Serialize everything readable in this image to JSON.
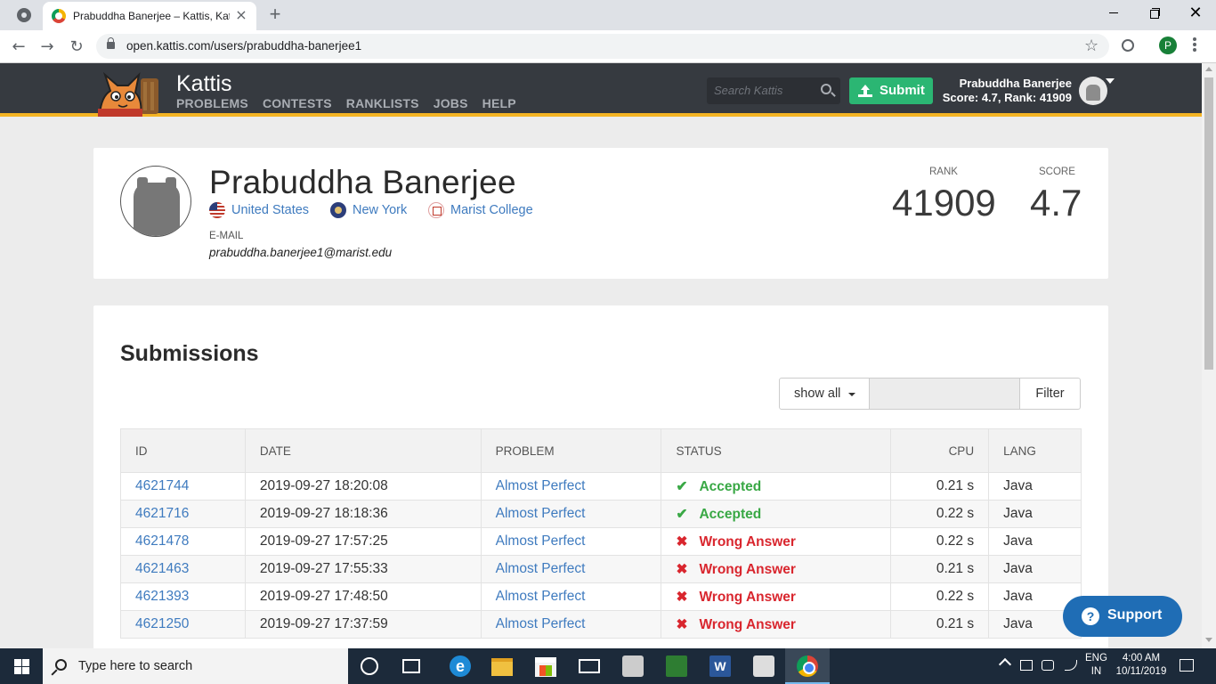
{
  "browser": {
    "tab_title": "Prabuddha Banerjee – Kattis, Kattis",
    "tab_close": "×",
    "new_tab": "+",
    "url": "open.kattis.com/users/prabuddha-banerjee1",
    "profile_initial": "P",
    "win_close": "✕",
    "back": "←",
    "forward": "→",
    "reload": "↻",
    "star": "☆"
  },
  "kattis_nav": {
    "brand": "Kattis",
    "links": [
      "PROBLEMS",
      "CONTESTS",
      "RANKLISTS",
      "JOBS",
      "HELP"
    ],
    "search_placeholder": "Search Kattis",
    "submit_label": "Submit",
    "user_name": "Prabuddha Banerjee",
    "user_score": "Score: 4.7, Rank: 41909"
  },
  "profile": {
    "name": "Prabuddha Banerjee",
    "country": "United States",
    "state": "New York",
    "school": "Marist College",
    "email_label": "E-MAIL",
    "email": "prabuddha.banerjee1@marist.edu",
    "rank_label": "RANK",
    "rank": "41909",
    "score_label": "SCORE",
    "score": "4.7"
  },
  "submissions": {
    "title": "Submissions",
    "show_all": "show all",
    "filter_value": "",
    "filter_button": "Filter",
    "columns": [
      "ID",
      "DATE",
      "PROBLEM",
      "STATUS",
      "CPU",
      "LANG"
    ],
    "rows": [
      {
        "id": "4621744",
        "date": "2019-09-27 18:20:08",
        "problem": "Almost Perfect",
        "status": "Accepted",
        "ok": true,
        "cpu": "0.21 s",
        "lang": "Java"
      },
      {
        "id": "4621716",
        "date": "2019-09-27 18:18:36",
        "problem": "Almost Perfect",
        "status": "Accepted",
        "ok": true,
        "cpu": "0.22 s",
        "lang": "Java"
      },
      {
        "id": "4621478",
        "date": "2019-09-27 17:57:25",
        "problem": "Almost Perfect",
        "status": "Wrong Answer",
        "ok": false,
        "cpu": "0.22 s",
        "lang": "Java"
      },
      {
        "id": "4621463",
        "date": "2019-09-27 17:55:33",
        "problem": "Almost Perfect",
        "status": "Wrong Answer",
        "ok": false,
        "cpu": "0.21 s",
        "lang": "Java"
      },
      {
        "id": "4621393",
        "date": "2019-09-27 17:48:50",
        "problem": "Almost Perfect",
        "status": "Wrong Answer",
        "ok": false,
        "cpu": "0.22 s",
        "lang": "Java"
      },
      {
        "id": "4621250",
        "date": "2019-09-27 17:37:59",
        "problem": "Almost Perfect",
        "status": "Wrong Answer",
        "ok": false,
        "cpu": "0.21 s",
        "lang": "Java"
      }
    ]
  },
  "support_label": "Support",
  "taskbar": {
    "search_text": "Type here to search",
    "word_letter": "W",
    "edge_letter": "e",
    "lang_top": "ENG",
    "lang_bottom": "IN",
    "time": "4:00 AM",
    "date": "10/11/2019"
  },
  "colors": {
    "nav_bg": "#363a40",
    "nav_accent": "#f4b423",
    "submit_green": "#2bb673",
    "link_blue": "#3f7bbf",
    "accepted_green": "#39a845",
    "wrong_red": "#d9262e",
    "support_blue": "#1f6db5"
  }
}
